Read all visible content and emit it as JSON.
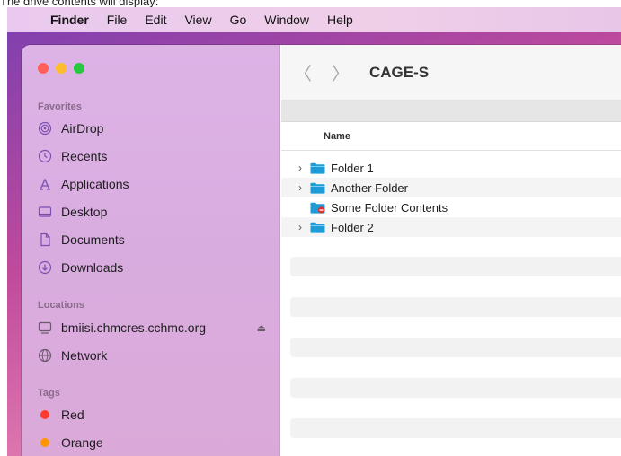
{
  "caption": "The drive contents will display:",
  "menubar": {
    "apple_icon": "apple-logo-icon",
    "items": [
      "Finder",
      "File",
      "Edit",
      "View",
      "Go",
      "Window",
      "Help"
    ]
  },
  "window": {
    "title": "CAGE-S",
    "column_name": "Name",
    "sidebar": {
      "favorites_header": "Favorites",
      "favorites": [
        {
          "label": "AirDrop",
          "icon": "airdrop-icon"
        },
        {
          "label": "Recents",
          "icon": "clock-icon"
        },
        {
          "label": "Applications",
          "icon": "applications-icon"
        },
        {
          "label": "Desktop",
          "icon": "desktop-icon"
        },
        {
          "label": "Documents",
          "icon": "document-icon"
        },
        {
          "label": "Downloads",
          "icon": "download-icon"
        }
      ],
      "locations_header": "Locations",
      "locations": [
        {
          "label": "bmiisi.chmcres.cchmc.org",
          "icon": "computer-icon",
          "eject": "⏏"
        },
        {
          "label": "Network",
          "icon": "globe-icon"
        }
      ],
      "tags_header": "Tags",
      "tags": [
        {
          "label": "Red",
          "color": "#ff3b30"
        },
        {
          "label": "Orange",
          "color": "#ff9500"
        }
      ]
    },
    "files": [
      {
        "name": "Folder 1",
        "expandable": true,
        "restricted": false
      },
      {
        "name": "Another Folder",
        "expandable": true,
        "restricted": false
      },
      {
        "name": "Some Folder Contents",
        "expandable": false,
        "restricted": true
      },
      {
        "name": "Folder 2",
        "expandable": true,
        "restricted": false
      }
    ]
  }
}
